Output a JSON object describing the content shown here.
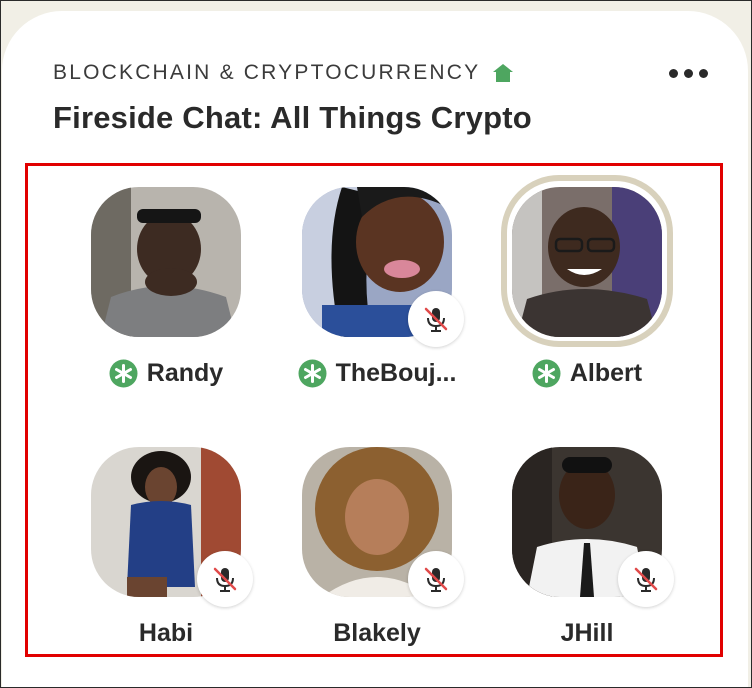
{
  "room": {
    "club_name": "BLOCKCHAIN & CRYPTOCURRENCY",
    "title": "Fireside Chat: All Things Crypto"
  },
  "icons": {
    "club": "house-icon",
    "menu": "more-options-icon",
    "moderator": "moderator-asterisk-icon",
    "muted": "muted-mic-icon"
  },
  "colors": {
    "moderator_green": "#4ea660",
    "mute_red": "#e04a4a",
    "speaking_ring": "#d8d1bc",
    "highlight_border": "#e10000"
  },
  "speakers": [
    {
      "name": "Randy",
      "moderator": true,
      "muted": false,
      "speaking": false
    },
    {
      "name": "TheBouj...",
      "moderator": true,
      "muted": true,
      "speaking": false
    },
    {
      "name": "Albert",
      "moderator": true,
      "muted": false,
      "speaking": true
    },
    {
      "name": "Habi",
      "moderator": false,
      "muted": true,
      "speaking": false
    },
    {
      "name": "Blakely",
      "moderator": false,
      "muted": true,
      "speaking": false
    },
    {
      "name": "JHill",
      "moderator": false,
      "muted": true,
      "speaking": false
    }
  ]
}
